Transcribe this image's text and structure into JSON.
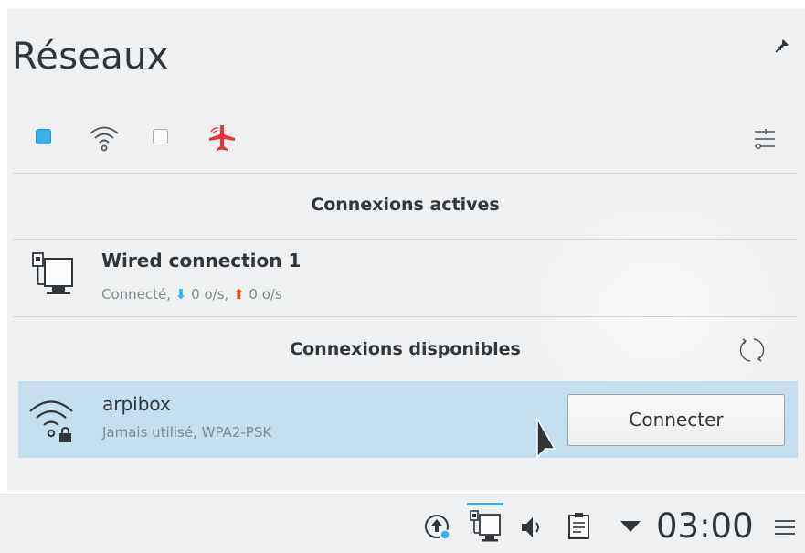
{
  "header": {
    "title": "Réseaux"
  },
  "toolbar": {
    "wired_enabled": true,
    "wireless_enabled": false,
    "airplane_mode": true
  },
  "active_section": {
    "title": "Connexions actives",
    "connections": [
      {
        "name": "Wired connection 1",
        "status_prefix": "Connecté, ",
        "down": "0 o/s",
        "sep": ", ",
        "up": "0 o/s",
        "icon": "wired-network-icon"
      }
    ]
  },
  "available_section": {
    "title": "Connexions disponibles",
    "networks": [
      {
        "ssid": "arpibox",
        "desc": "Jamais utilisé, WPA2-PSK",
        "icon": "wifi-locked-icon",
        "button": "Connecter"
      }
    ]
  },
  "taskbar": {
    "clock": "03:00"
  },
  "colors": {
    "accent": "#3daee9",
    "selection": "#c5dfef",
    "airplane": "#e8363c",
    "upload": "#e0521b",
    "background": "#eff0f1",
    "text": "#31363b"
  }
}
